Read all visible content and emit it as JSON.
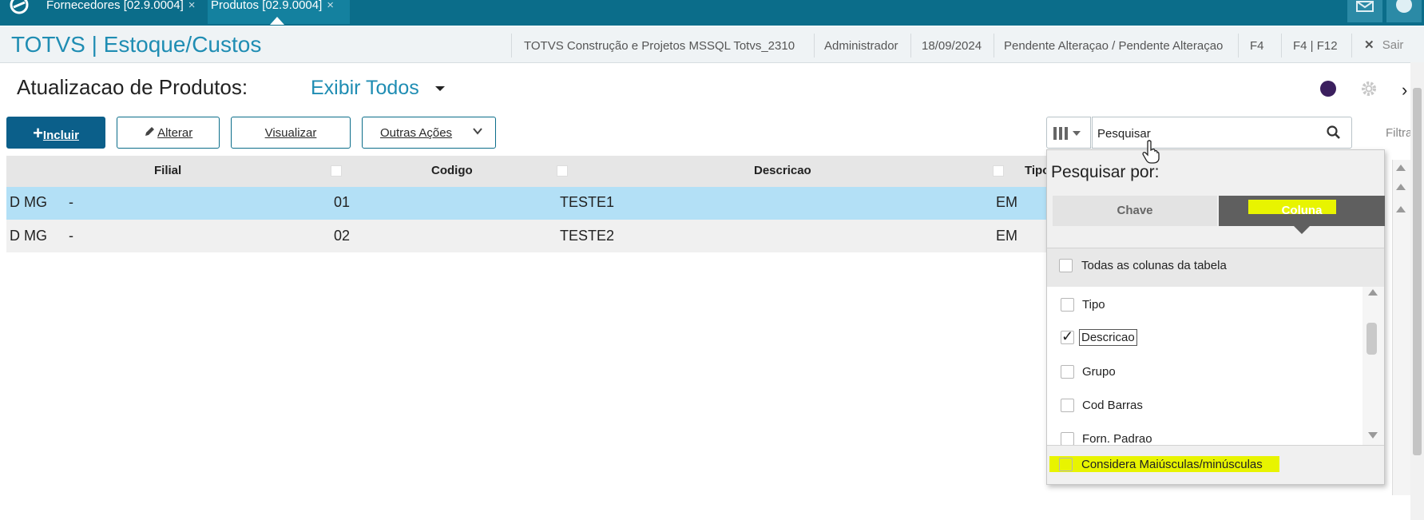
{
  "tabs": [
    {
      "label": "Fornecedores [02.9.0004]",
      "close": "×"
    },
    {
      "label": "Produtos [02.9.0004]",
      "close": "×"
    }
  ],
  "header": {
    "title": "TOTVS | Estoque/Custos",
    "company": "TOTVS Construção e Projetos MSSQL Totvs_2310",
    "user": "Administrador",
    "date": "18/09/2024",
    "status": "Pendente Alteraçao / Pendente Alteraçao",
    "shortcut1": "F4",
    "shortcut2": "F4 | F12",
    "exit_icon": "✕",
    "exit_label": "Sair"
  },
  "page": {
    "title": "Atualizacao de Produtos:",
    "view_selector": "Exibir Todos"
  },
  "toolbar": {
    "incluir_plus": "+",
    "incluir_label": "Incluir",
    "alterar_label": "Alterar",
    "visualizar_label": "Visualizar",
    "outras_label": "Outras Ações"
  },
  "search": {
    "value": "Pesquisar",
    "filter_label": "Filtra"
  },
  "grid": {
    "columns": [
      "Filial",
      "Codigo",
      "Descricao",
      "Tipo"
    ],
    "rows": [
      {
        "filial": "D MG",
        "sep": "-",
        "codigo": "01",
        "descricao": "TESTE1",
        "tipo": "EM"
      },
      {
        "filial": "D MG",
        "sep": "-",
        "codigo": "02",
        "descricao": "TESTE2",
        "tipo": "EM"
      }
    ]
  },
  "search_panel": {
    "title": "Pesquisar por:",
    "tab_key": "Chave",
    "tab_column": "Coluna",
    "all_columns": "Todas as colunas da tabela",
    "columns": [
      {
        "label": "Tipo",
        "checked": false
      },
      {
        "label": "Descricao",
        "checked": true
      },
      {
        "label": "Grupo",
        "checked": false
      },
      {
        "label": "Cod Barras",
        "checked": false
      },
      {
        "label": "Forn. Padrao",
        "checked": false
      }
    ],
    "case_sensitive": "Considera Maiúsculas/minúsculas",
    "check_glyph": "✓"
  },
  "colors": {
    "topbar": "#0b6d8a",
    "accent": "#1f8db3",
    "primary_button": "#0b5f8a",
    "selected_row": "#b3e0f6",
    "highlight": "#e8f400"
  }
}
